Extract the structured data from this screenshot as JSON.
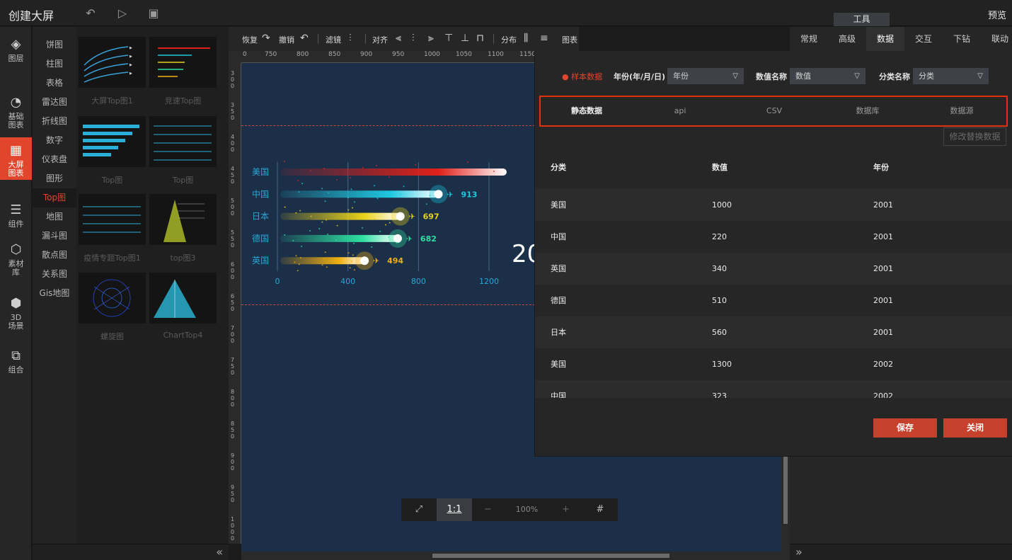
{
  "app": {
    "title": "创建大屏",
    "preview": "预览",
    "tool_tab": "工具"
  },
  "leftnav": [
    {
      "label": "图层",
      "icon": "layers-icon"
    },
    {
      "label": "基础\n图表",
      "icon": "pie-chart-icon"
    },
    {
      "label": "大屏\n图表",
      "icon": "screen-chart-icon",
      "active": true
    },
    {
      "label": "组件",
      "icon": "sliders-icon"
    },
    {
      "label": "素材\n库",
      "icon": "hexagons-icon"
    },
    {
      "label": "3D\n场景",
      "icon": "cube-icon"
    },
    {
      "label": "组合",
      "icon": "combine-icon"
    }
  ],
  "categories": [
    "饼图",
    "柱图",
    "表格",
    "雷达图",
    "折线图",
    "数字",
    "仪表盘",
    "图形",
    "Top图",
    "地图",
    "漏斗图",
    "散点图",
    "关系图",
    "Gis地图"
  ],
  "active_category": "Top图",
  "thumbnails": [
    "大屏Top图1",
    "竞速Top图",
    "Top图",
    "Top图",
    "疫情专题Top图1",
    "top图3",
    "螺旋图",
    "ChartTop4"
  ],
  "toolbar": {
    "redo": "恢复",
    "undo": "撤销",
    "filter": "滤镜",
    "align": "对齐",
    "distribute": "分布",
    "chart": "图表"
  },
  "ruler_top": [
    "0",
    "750",
    "800",
    "850",
    "900",
    "950",
    "1000",
    "1050",
    "1100",
    "1150"
  ],
  "ruler_left": [
    "300",
    "350",
    "400",
    "450",
    "500",
    "550",
    "600",
    "650",
    "700",
    "750",
    "800",
    "850",
    "900",
    "950",
    "1000"
  ],
  "zoom": {
    "fit": "⤢",
    "one_to_one": "1:1",
    "minus": "−",
    "level": "100%",
    "plus": "+",
    "grid": "#"
  },
  "right_tabs": [
    "常规",
    "高级",
    "数据",
    "交互",
    "下钻",
    "联动"
  ],
  "active_right_tab": "数据",
  "dialog": {
    "sample": "样本数据",
    "year_label": "年份(年/月/日)",
    "year_value": "年份",
    "value_label": "数值名称",
    "value_value": "数值",
    "category_label": "分类名称",
    "category_value": "分类",
    "sources": [
      "静态数据",
      "api",
      "CSV",
      "数据库",
      "数据源"
    ],
    "active_source": "静态数据",
    "modify": "修改替换数据",
    "headers": [
      "分类",
      "数值",
      "年份"
    ],
    "rows": [
      [
        "美国",
        "1000",
        "2001"
      ],
      [
        "中国",
        "220",
        "2001"
      ],
      [
        "英国",
        "340",
        "2001"
      ],
      [
        "德国",
        "510",
        "2001"
      ],
      [
        "日本",
        "560",
        "2001"
      ],
      [
        "美国",
        "1300",
        "2002"
      ],
      [
        "中国",
        "323",
        "2002"
      ]
    ],
    "save": "保存",
    "close": "关闭"
  },
  "chart_data": {
    "type": "bar",
    "orientation": "horizontal",
    "categories": [
      "美国",
      "中国",
      "日本",
      "德国",
      "英国"
    ],
    "values": [
      1300,
      913,
      697,
      682,
      494
    ],
    "value_labels": [
      "",
      "913",
      "697",
      "682",
      "494"
    ],
    "xticks": [
      "0",
      "400",
      "800",
      "1200"
    ],
    "xlim": [
      0,
      1200
    ],
    "year_text": "20",
    "colors": [
      "#e0201a",
      "#1ec8e0",
      "#e8d21a",
      "#2ee0a0",
      "#f0b010"
    ],
    "label_color": "#2aa7d6"
  }
}
